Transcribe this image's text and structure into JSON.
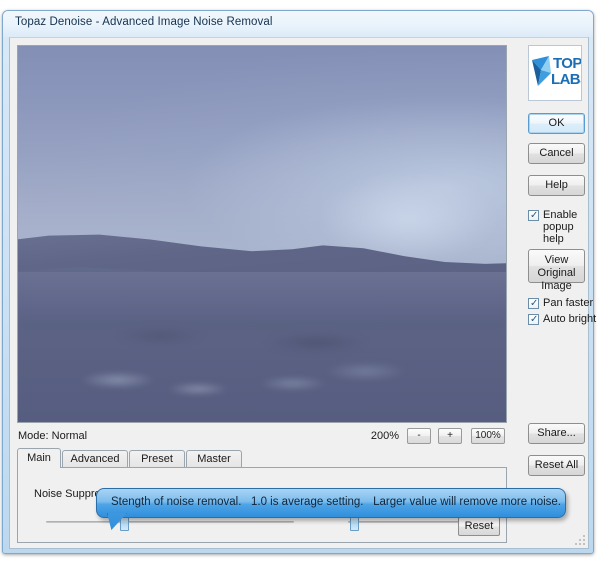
{
  "window": {
    "title": "Topaz Denoise - Advanced Image Noise Removal"
  },
  "preview": {
    "alt": "blurry photo of a hillside landscape under a hazy blue sky"
  },
  "mode_bar": {
    "mode_label": "Mode: Normal",
    "zoom_level": "200%",
    "zoom_out_label": "-",
    "zoom_in_label": "+",
    "zoom_100_label": "100%"
  },
  "tabs": [
    {
      "label": "Main",
      "active": true
    },
    {
      "label": "Advanced",
      "active": false
    },
    {
      "label": "Preset",
      "active": false
    },
    {
      "label": "Master",
      "active": false
    }
  ],
  "tab_panel": {
    "param_label": "Noise Suppression",
    "reset_label": "Reset"
  },
  "tooltip": {
    "text": "Stength of noise removal.   1.0 is average setting.   Larger value will remove more noise."
  },
  "sidebar": {
    "logo": {
      "brand_top": "TOPAZ",
      "brand_bottom": "LABS"
    },
    "ok_label": "OK",
    "cancel_label": "Cancel",
    "help_label": "Help",
    "enable_popup_help": {
      "label": "Enable\npopup help",
      "checked": true,
      "tick": "✓"
    },
    "view_original_label": "View Original\nImage",
    "pan_faster": {
      "label": "Pan faster",
      "checked": true,
      "tick": "✓"
    },
    "auto_bright": {
      "label": "Auto bright",
      "checked": true,
      "tick": "✓"
    },
    "share_label": "Share...",
    "reset_all_label": "Reset All"
  },
  "colors": {
    "accent": "#2f8fdc",
    "window_frame": "#bcd8ef",
    "brand_blue": "#1c6fb4",
    "panel_bg": "#f0f0f0"
  }
}
